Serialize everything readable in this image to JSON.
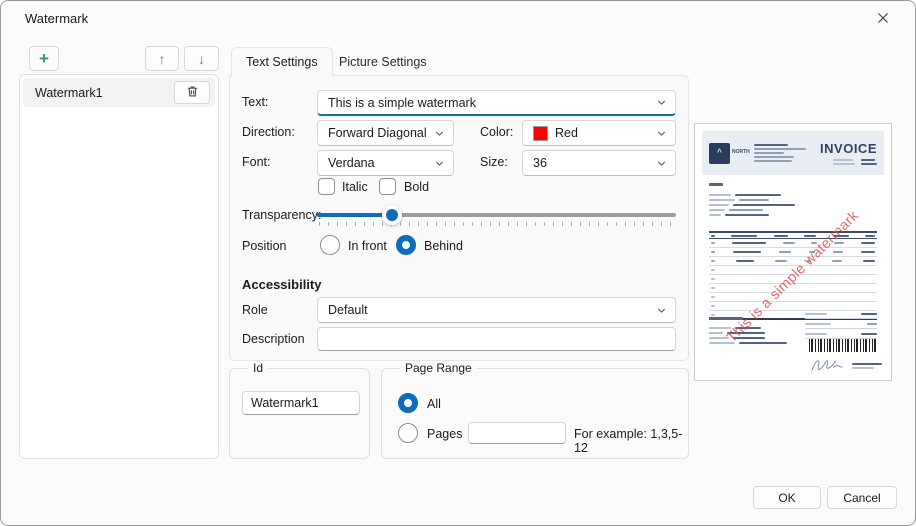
{
  "window": {
    "title": "Watermark"
  },
  "icons": {
    "add": "+",
    "move_up": "↑",
    "move_down": "↓"
  },
  "sidebar": {
    "items": [
      {
        "label": "Watermark1"
      }
    ]
  },
  "tabs": {
    "text": "Text Settings",
    "picture": "Picture Settings"
  },
  "form": {
    "text_label": "Text:",
    "text_value": "This is a simple watermark",
    "direction_label": "Direction:",
    "direction_value": "Forward Diagonal",
    "color_label": "Color:",
    "color_value": "Red",
    "color_swatch": "#fe0000",
    "font_label": "Font:",
    "font_value": "Verdana",
    "size_label": "Size:",
    "size_value": "36",
    "italic_label": "Italic",
    "italic_checked": false,
    "bold_label": "Bold",
    "bold_checked": false,
    "transparency_label": "Transparency:",
    "transparency_percent": 21,
    "position_label": "Position",
    "position_options": [
      {
        "label": "In front",
        "selected": false
      },
      {
        "label": "Behind",
        "selected": true
      }
    ],
    "accessibility_header": "Accessibility",
    "role_label": "Role",
    "role_value": "Default",
    "description_label": "Description",
    "description_value": ""
  },
  "id_group": {
    "legend": "Id",
    "value": "Watermark1"
  },
  "page_range": {
    "legend": "Page Range",
    "options": [
      {
        "label": "All",
        "selected": true
      },
      {
        "label": "Pages",
        "selected": false
      }
    ],
    "pages_value": "",
    "hint": "For example: 1,3,5-12"
  },
  "preview": {
    "brand": "NORTH",
    "doc_title": "INVOICE",
    "watermark_text": "This is a simple watermark",
    "watermark_color": "#d94848"
  },
  "footer": {
    "ok": "OK",
    "cancel": "Cancel"
  },
  "colors": {
    "accent": "#0f6cbd",
    "green": "#2f9e5f"
  }
}
